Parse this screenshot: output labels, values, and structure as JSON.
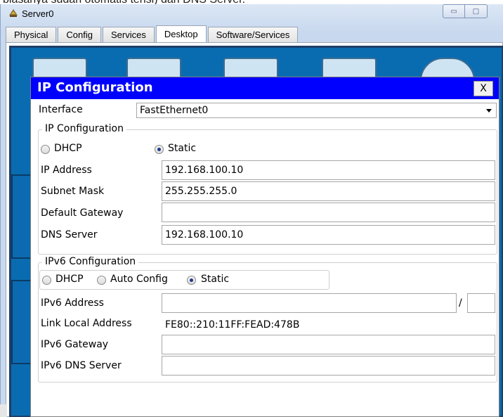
{
  "background_text": "biasanya sudah otomatis terisi) dan DNS Server.",
  "window": {
    "title": "Server0",
    "minimize_glyph": "▭",
    "maximize_glyph": "□"
  },
  "tabs": [
    {
      "label": "Physical",
      "active": false
    },
    {
      "label": "Config",
      "active": false
    },
    {
      "label": "Services",
      "active": false
    },
    {
      "label": "Desktop",
      "active": true
    },
    {
      "label": "Software/Services",
      "active": false
    }
  ],
  "dialog": {
    "title": "IP Configuration",
    "close_label": "X",
    "interface_label": "Interface",
    "interface_value": "FastEthernet0",
    "ipv4": {
      "legend": "IP Configuration",
      "dhcp_label": "DHCP",
      "static_label": "Static",
      "selected": "Static",
      "ip_address_label": "IP Address",
      "ip_address_value": "192.168.100.10",
      "subnet_mask_label": "Subnet Mask",
      "subnet_mask_value": "255.255.255.0",
      "gateway_label": "Default Gateway",
      "gateway_value": "",
      "dns_label": "DNS Server",
      "dns_value": "192.168.100.10"
    },
    "ipv6": {
      "legend": "IPv6 Configuration",
      "dhcp_label": "DHCP",
      "auto_label": "Auto Config",
      "static_label": "Static",
      "selected": "Static",
      "address_label": "IPv6 Address",
      "address_value": "",
      "prefix_separator": "/",
      "prefix_value": "",
      "link_local_label": "Link Local Address",
      "link_local_value": "FE80::210:11FF:FEAD:478B",
      "gateway_label": "IPv6 Gateway",
      "gateway_value": "",
      "dns_label": "IPv6 DNS Server",
      "dns_value": ""
    }
  },
  "colors": {
    "dialog_title_bg": "#0000ff",
    "desktop_bg": "#0a6cb0"
  }
}
